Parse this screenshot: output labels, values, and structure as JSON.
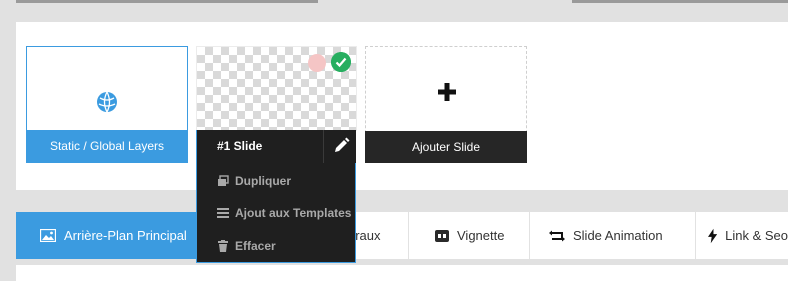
{
  "slides": {
    "static_label": "Static / Global Layers",
    "add_label": "Ajouter Slide"
  },
  "slide_menu": {
    "title": "#1 Slide",
    "items": [
      {
        "label": "Dupliquer",
        "icon": "duplicate-icon"
      },
      {
        "label": "Ajout aux Templates",
        "icon": "list-icon"
      },
      {
        "label": "Effacer",
        "icon": "trash-icon"
      }
    ]
  },
  "tabs": [
    {
      "label": "Arrière-Plan Principal",
      "icon": "image-icon",
      "active": true
    },
    {
      "label": "éraux",
      "icon": ""
    },
    {
      "label": "Vignette",
      "icon": "thumbnail-icon"
    },
    {
      "label": "Slide Animation",
      "icon": "animation-icon"
    },
    {
      "label": "Link & Seo",
      "icon": "lightning-icon"
    }
  ],
  "colors": {
    "accent": "#3b9be0",
    "dark": "#1f1f1f",
    "success": "#27ae60"
  }
}
